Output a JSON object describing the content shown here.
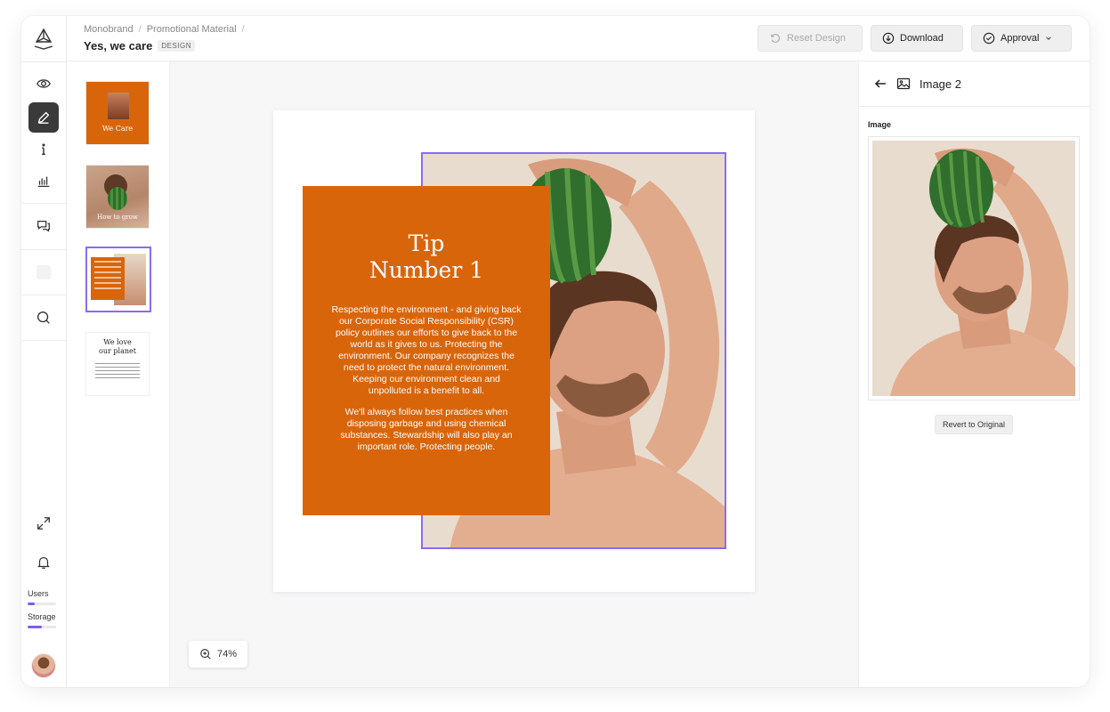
{
  "header": {
    "breadcrumb": [
      "Monobrand",
      "Promotional Material"
    ],
    "title": "Yes, we care",
    "badge": "DESIGN",
    "buttons": {
      "reset": "Reset Design",
      "download": "Download",
      "approval": "Approval"
    }
  },
  "rail": {
    "users_label": "Users",
    "storage_label": "Storage",
    "users_usage": 0.25,
    "storage_usage": 0.5
  },
  "thumbnails": [
    {
      "label": "We Care"
    },
    {
      "label": "How to grow"
    },
    {
      "label": ""
    },
    {
      "label_line1": "We love",
      "label_line2": "our planet"
    }
  ],
  "design": {
    "tip_title_line1": "Tip",
    "tip_title_line2": "Number 1",
    "paragraph1": "Respecting the environment - and giving back our Corporate Social Responsibility (CSR) policy outlines our efforts to give back to the world as it gives to us. Protecting the environment. Our company recognizes the need to protect the natural environment. Keeping our environment clean and unpolluted is a benefit to all.",
    "paragraph2": "We'll always follow best practices when disposing garbage and using chemical substances. Stewardship will also play an important role. Protecting people."
  },
  "zoom": {
    "value": "74%"
  },
  "panel": {
    "title": "Image 2",
    "field_label": "Image",
    "revert_label": "Revert to Original"
  },
  "colors": {
    "accent": "#8a6cf0",
    "brand_orange": "#d9650b"
  }
}
